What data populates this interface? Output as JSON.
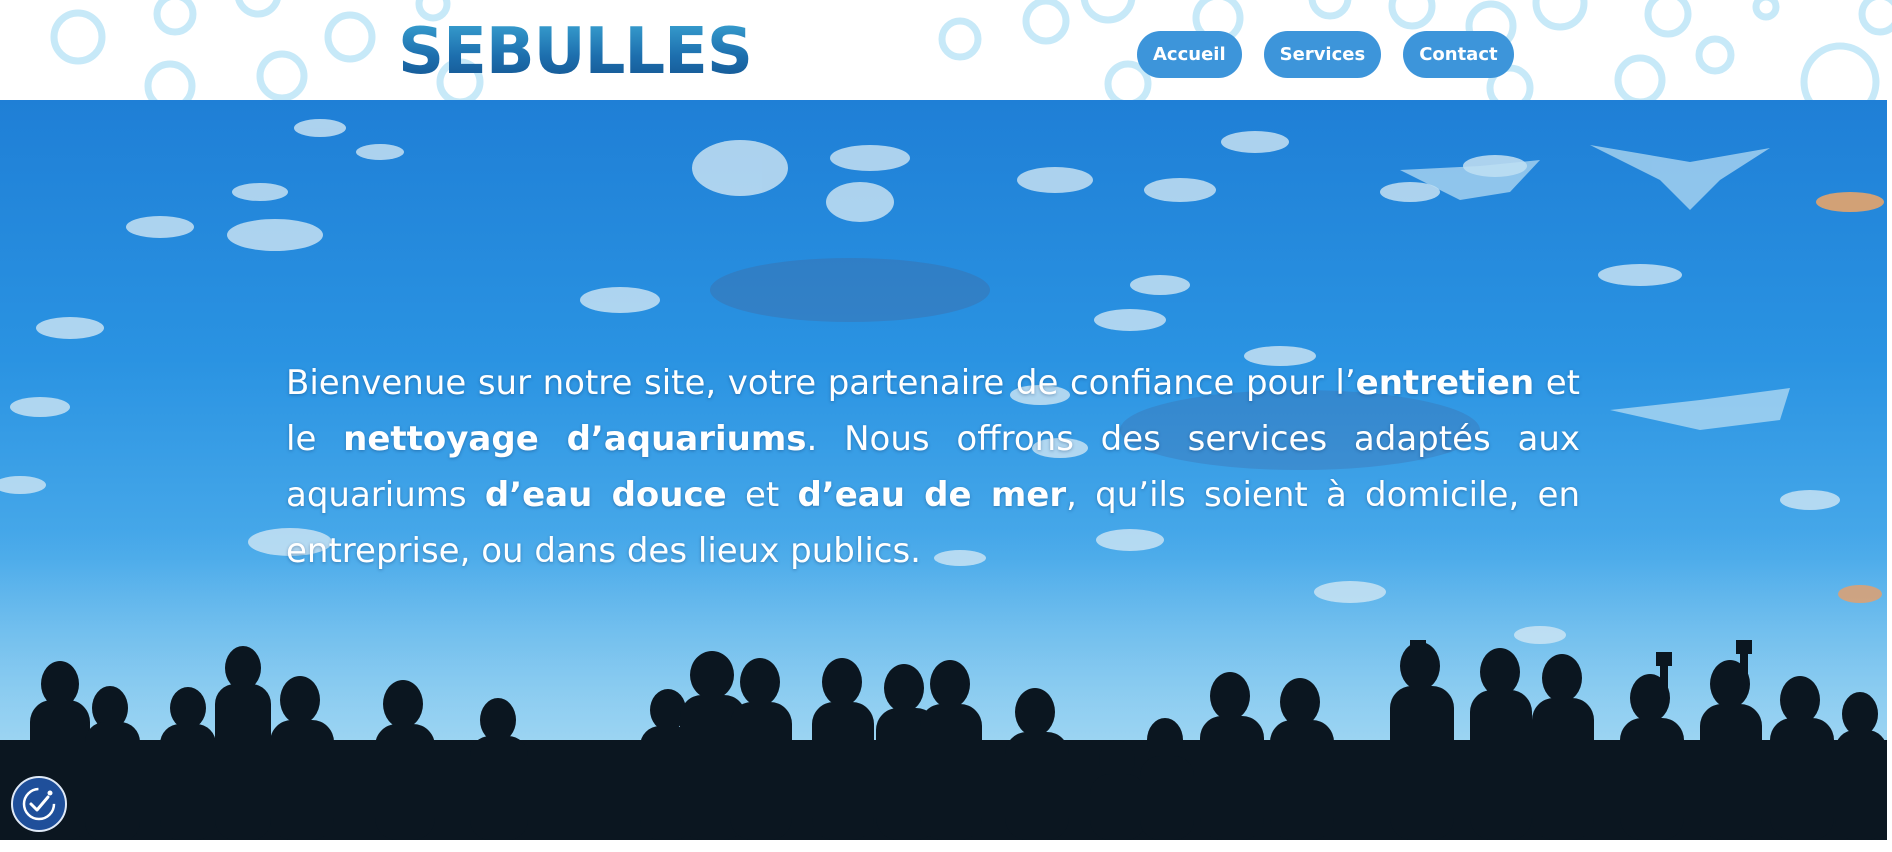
{
  "site": {
    "logo_text": "SEBULLES"
  },
  "nav": {
    "items": [
      {
        "label": "Accueil"
      },
      {
        "label": "Services"
      },
      {
        "label": "Contact"
      }
    ]
  },
  "hero": {
    "segments": [
      {
        "text": "Bienvenue sur notre site, votre partenaire de confiance pour l’",
        "bold": false
      },
      {
        "text": "entretien",
        "bold": true
      },
      {
        "text": " et le ",
        "bold": false
      },
      {
        "text": "nettoyage d’aquariums",
        "bold": true
      },
      {
        "text": ". Nous offrons des services adaptés aux aquariums ",
        "bold": false
      },
      {
        "text": "d’eau douce",
        "bold": true
      },
      {
        "text": " et ",
        "bold": false
      },
      {
        "text": "d’eau de mer",
        "bold": true
      },
      {
        "text": ", qu’ils soient à domicile, en entreprise, ou dans des lieux publics.",
        "bold": false
      }
    ]
  },
  "icons": {
    "accessibility": "accessibility-icon"
  },
  "colors": {
    "nav_button": "#3d95da",
    "logo_gradient_top": "#3ea9d6",
    "logo_gradient_bottom": "#124f8a",
    "accessibility_button": "#1f4f9a"
  }
}
